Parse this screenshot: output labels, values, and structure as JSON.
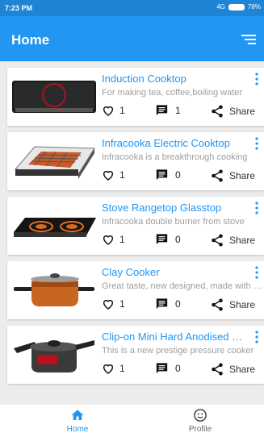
{
  "status_bar": {
    "time": "7:23 PM",
    "network": "4G",
    "battery": "78%"
  },
  "app_bar": {
    "title": "Home"
  },
  "colors": {
    "primary": "#2296f3",
    "status_bar": "#1f84d6",
    "title_text": "#2196f3",
    "desc_text": "#9e9e9e"
  },
  "products": [
    {
      "title": "Induction Cooktop",
      "description": "For making tea, coffee,boiling water",
      "likes": "1",
      "comments": "1",
      "share_label": "Share",
      "image_icon": "induction-cooktop-image"
    },
    {
      "title": "Infracooka Electric Cooktop",
      "description": "Infracooka is a breakthrough cooking",
      "likes": "1",
      "comments": "0",
      "share_label": "Share",
      "image_icon": "electric-cooktop-grill-image"
    },
    {
      "title": "Stove Rangetop Glasstop",
      "description": "Infracooka double burner from stove",
      "likes": "1",
      "comments": "0",
      "share_label": "Share",
      "image_icon": "double-burner-glasstop-image"
    },
    {
      "title": "Clay Cooker",
      "description": "Great taste, new designed, made with clay",
      "likes": "1",
      "comments": "0",
      "share_label": "Share",
      "image_icon": "clay-cooker-pot-image"
    },
    {
      "title": "Clip-on Mini Hard Anodised Pressure Cooker",
      "description": "This is a new prestige pressure cooker",
      "likes": "1",
      "comments": "0",
      "share_label": "Share",
      "image_icon": "pressure-cooker-image"
    }
  ],
  "bottom_nav": [
    {
      "label": "Home",
      "icon": "home-icon",
      "active": true
    },
    {
      "label": "Profile",
      "icon": "smiley-face-icon",
      "active": false
    }
  ]
}
